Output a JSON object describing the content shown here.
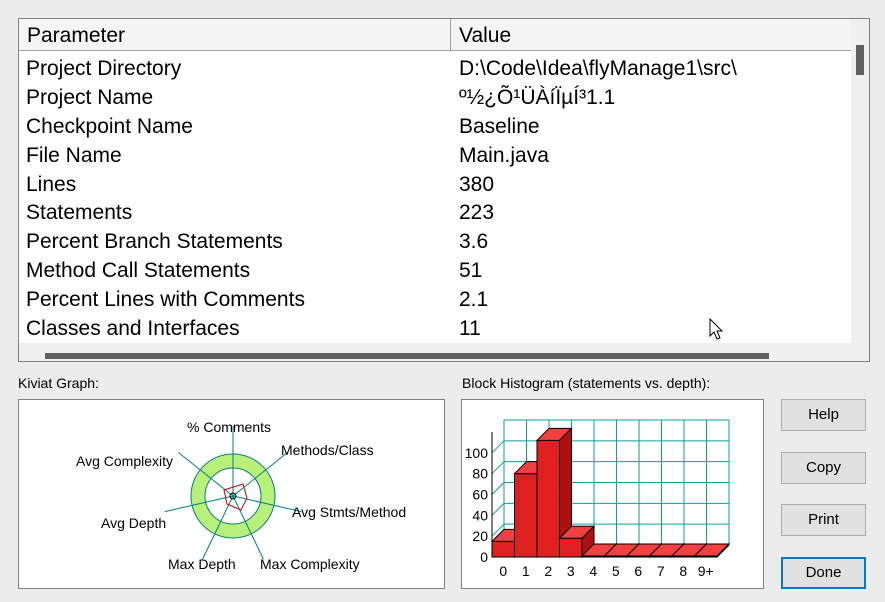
{
  "grid": {
    "headers": {
      "parameter": "Parameter",
      "value": "Value"
    },
    "rows": [
      {
        "parameter": "Project Directory",
        "value": "D:\\Code\\Idea\\flyManage1\\src\\"
      },
      {
        "parameter": "Project Name",
        "value": "º½¿Õ¹ÜÀíÏµÍ³1.1"
      },
      {
        "parameter": "Checkpoint Name",
        "value": "Baseline"
      },
      {
        "parameter": "File Name",
        "value": "Main.java"
      },
      {
        "parameter": "Lines",
        "value": "380"
      },
      {
        "parameter": "Statements",
        "value": "223"
      },
      {
        "parameter": "Percent Branch Statements",
        "value": "3.6"
      },
      {
        "parameter": "Method Call Statements",
        "value": "51"
      },
      {
        "parameter": "Percent Lines with Comments",
        "value": "2.1"
      },
      {
        "parameter": "Classes and Interfaces",
        "value": "11"
      }
    ]
  },
  "kiviat": {
    "label": "Kiviat Graph:",
    "axes": [
      "% Comments",
      "Methods/Class",
      "Avg Stmts/Method",
      "Max Complexity",
      "Max Depth",
      "Avg Depth",
      "Avg Complexity"
    ],
    "colors": {
      "outer_ring": "#b8f07a",
      "inner_ring": "#ffffff",
      "plot_line": "#cc0000"
    }
  },
  "histogram": {
    "label": "Block Histogram (statements vs. depth):",
    "categories": [
      "0",
      "1",
      "2",
      "3",
      "4",
      "5",
      "6",
      "7",
      "8",
      "9+"
    ],
    "values": [
      15,
      80,
      112,
      18,
      1,
      1,
      1,
      1,
      1,
      1
    ],
    "y_ticks": [
      "0",
      "20",
      "40",
      "60",
      "80",
      "100"
    ],
    "ylim": [
      0,
      120
    ],
    "bar_color": "#e02020",
    "grid_color": "#0aa0a0"
  },
  "buttons": {
    "help": "Help",
    "copy": "Copy",
    "print": "Print",
    "done": "Done"
  }
}
